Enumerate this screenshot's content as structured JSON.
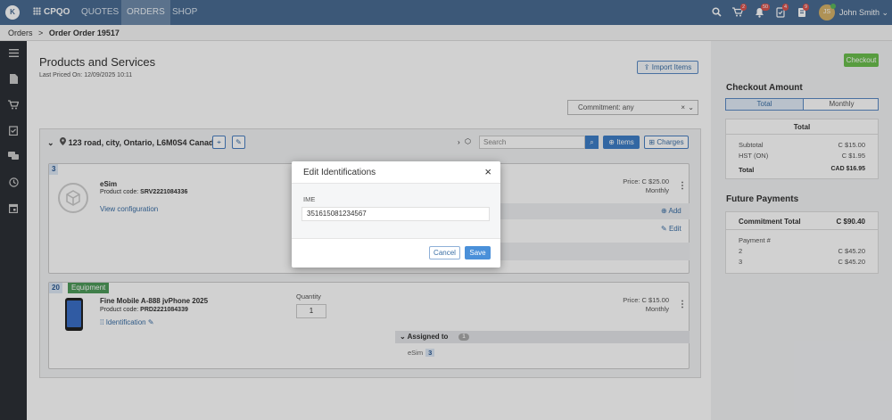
{
  "topbar": {
    "logo": "K",
    "brand": "CPQO",
    "nav": [
      "QUOTES",
      "ORDERS",
      "SHOP"
    ],
    "badges": {
      "cart": "2",
      "bell": "50",
      "tasks": "4",
      "docs": "9"
    },
    "avatar_initials": "JS",
    "user_name": "John Smith",
    "icons": [
      "search-icon",
      "cart-icon",
      "bell-icon",
      "tasks-icon",
      "docs-icon",
      "chevron-down-icon"
    ]
  },
  "breadcrumb": {
    "root": "Orders",
    "separator": ">",
    "current": "Order Order 19517"
  },
  "main": {
    "title": "Products and Services",
    "last_priced_label": "Last Priced On:",
    "last_priced_value": "12/09/2025 10:11",
    "import_button": "Import Items",
    "commitment_select": "Commitment: any",
    "address": "123 road, city, Ontario, L6M0S4 Canada",
    "search_placeholder": "Search",
    "items_button": "Items",
    "charges_button": "Charges"
  },
  "products": [
    {
      "number": "3",
      "name": "eSim",
      "code_label": "Product code:",
      "code": "SRV2221084336",
      "link": "View configuration",
      "price_label": "Price:",
      "price": "C $25.00",
      "period": "Monthly",
      "add_label": "Add",
      "edit_label": "Edit"
    },
    {
      "number": "20",
      "badge": "Equipment",
      "name": "Fine Mobile A-888 jvPhone 2025",
      "code_label": "Product code:",
      "code": "PRD2221084339",
      "link": "Identification",
      "quantity_label": "Quantity",
      "quantity": "1",
      "price_label": "Price:",
      "price": "C $15.00",
      "period": "Monthly",
      "assigned_label": "Assigned to",
      "assigned_count": "1",
      "assigned_item": "eSim",
      "assigned_item_number": "3"
    }
  ],
  "checkout": {
    "button": "Checkout",
    "title": "Checkout Amount",
    "tabs": [
      "Total",
      "Monthly"
    ],
    "box_title": "Total",
    "rows": [
      {
        "label": "Subtotal",
        "value": "C $15.00"
      },
      {
        "label": "HST (ON)",
        "value": "C $1.95"
      },
      {
        "label": "Total",
        "value": "CAD $16.95"
      }
    ]
  },
  "future": {
    "title": "Future Payments",
    "commitment_label": "Commitment Total",
    "commitment_value": "C $90.40",
    "payment_header": "Payment #",
    "payments": [
      {
        "label": "2",
        "value": "C $45.20"
      },
      {
        "label": "3",
        "value": "C $45.20"
      }
    ]
  },
  "modal": {
    "title": "Edit Identifications",
    "field_label": "IME",
    "field_value": "351615081234567",
    "cancel": "Cancel",
    "save": "Save"
  }
}
